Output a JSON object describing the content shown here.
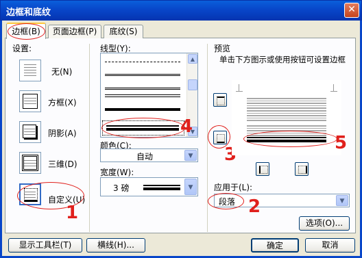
{
  "window": {
    "title": "边框和底纹",
    "close_icon": "close-icon"
  },
  "tabs": [
    {
      "label": "边框(B)",
      "selected": true
    },
    {
      "label": "页面边框(P)",
      "selected": false
    },
    {
      "label": "底纹(S)",
      "selected": false
    }
  ],
  "settings": {
    "label": "设置:",
    "items": [
      {
        "label": "无(N)"
      },
      {
        "label": "方框(X)"
      },
      {
        "label": "阴影(A)"
      },
      {
        "label": "三维(D)"
      },
      {
        "label": "自定义(U)",
        "selected": true
      }
    ]
  },
  "line_style": {
    "label": "线型(Y):"
  },
  "color": {
    "label": "颜色(C):",
    "value": "自动"
  },
  "width": {
    "label": "宽度(W):",
    "value": "3 磅"
  },
  "preview": {
    "label": "预览",
    "hint": "单击下方图示或使用按钮可设置边框"
  },
  "apply_to": {
    "label": "应用于(L):",
    "value": "段落"
  },
  "buttons": {
    "options": "选项(O)...",
    "show_toolbar": "显示工具栏(T)",
    "horizontal_line": "横线(H)...",
    "ok": "确定",
    "cancel": "取消"
  },
  "annotations": [
    "1",
    "2",
    "3",
    "4",
    "5"
  ],
  "colors": {
    "titlebar": "#0846C9",
    "annotation": "#E0201C",
    "dialog_bg": "#ECE9D8"
  }
}
